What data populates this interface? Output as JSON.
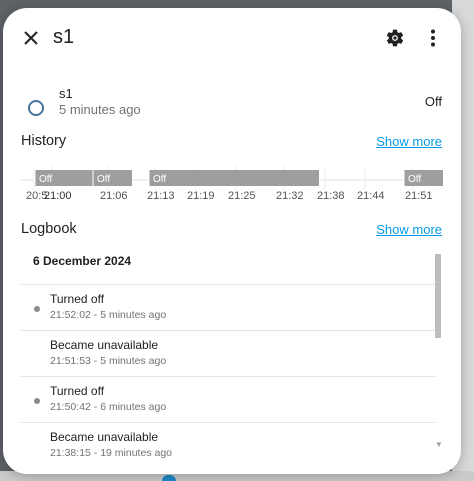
{
  "dialog": {
    "title": "s1"
  },
  "entity": {
    "name": "s1",
    "last_changed": "5 minutes ago",
    "state": "Off"
  },
  "history": {
    "title": "History",
    "show_more": "Show more",
    "segments": [
      {
        "label": "Off",
        "start": 0,
        "end": 1
      },
      {
        "label": "Off",
        "start": 1,
        "end": 2
      },
      {
        "label": "Off",
        "start": 2,
        "end": 3
      },
      {
        "label": "Off",
        "start": 3,
        "end": 4
      }
    ],
    "ticks": [
      "20:5",
      "21:00",
      "21:06",
      "21:13",
      "21:19",
      "21:25",
      "21:32",
      "21:38",
      "21:44",
      "21:51"
    ]
  },
  "logbook": {
    "title": "Logbook",
    "show_more": "Show more",
    "date": "6 December 2024",
    "entries": [
      {
        "text": "Turned off",
        "time": "21:52:02 - 5 minutes ago",
        "dot": true
      },
      {
        "text": "Became unavailable",
        "time": "21:51:53 - 5 minutes ago",
        "dot": false
      },
      {
        "text": "Turned off",
        "time": "21:50:42 - 6 minutes ago",
        "dot": true
      },
      {
        "text": "Became unavailable",
        "time": "21:38:15 - 19 minutes ago",
        "dot": false
      }
    ]
  },
  "colors": {
    "accent": "#039be5",
    "segment_off": "#9e9e9e",
    "entity_icon": "#44739e"
  }
}
